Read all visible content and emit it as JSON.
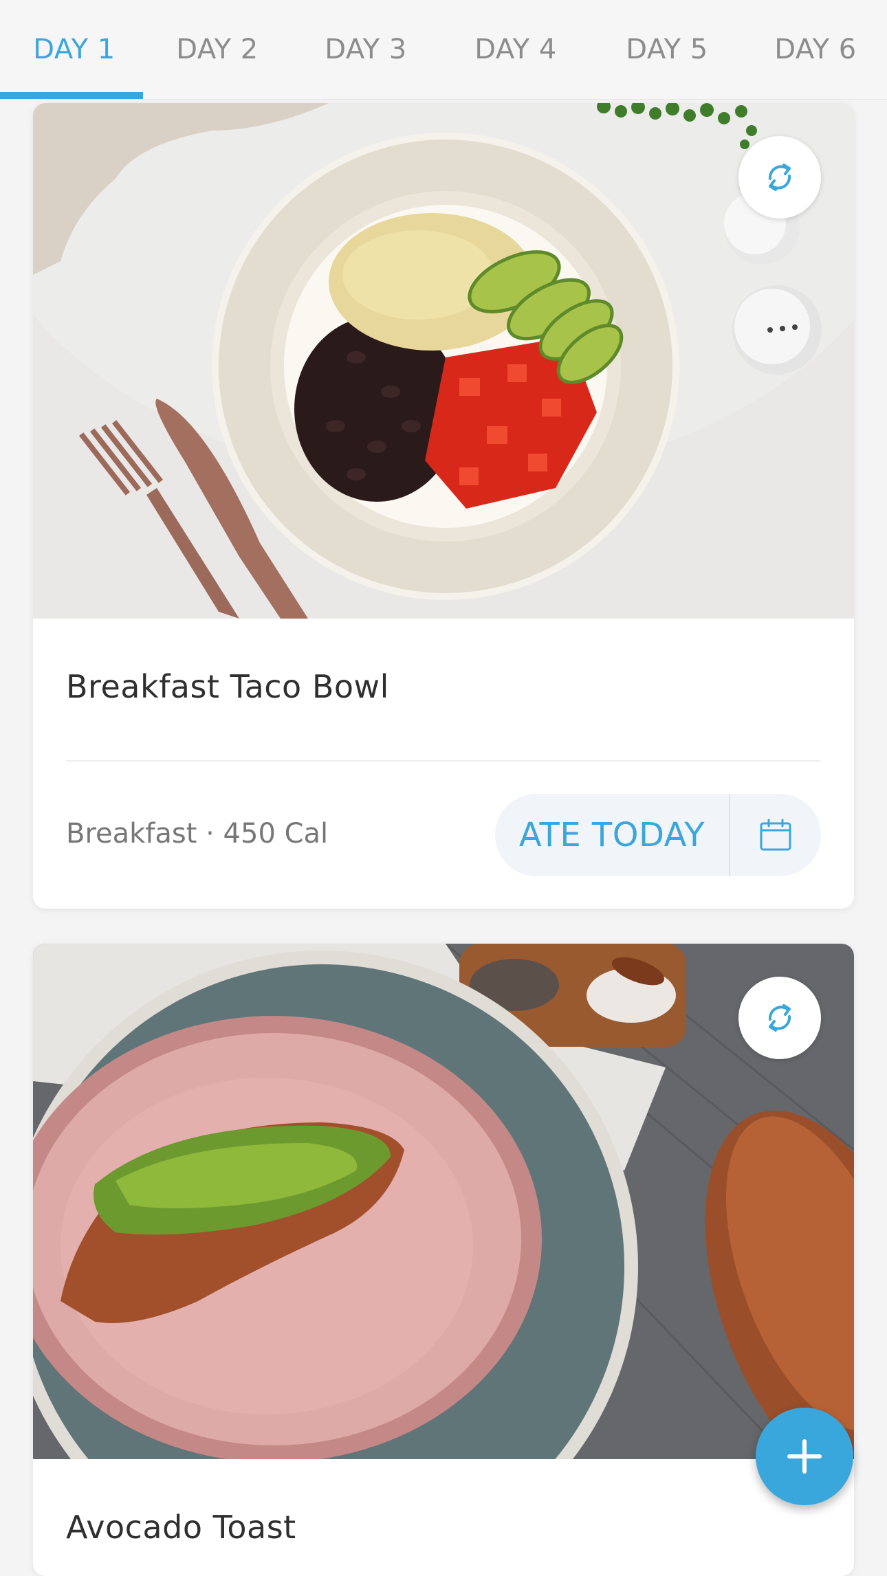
{
  "tabs": [
    {
      "label": "DAY 1",
      "active": true
    },
    {
      "label": "DAY 2",
      "active": false
    },
    {
      "label": "DAY 3",
      "active": false
    },
    {
      "label": "DAY 4",
      "active": false
    },
    {
      "label": "DAY 5",
      "active": false
    },
    {
      "label": "DAY 6",
      "active": false
    }
  ],
  "meals": [
    {
      "title": "Breakfast Taco Bowl",
      "meta": "Breakfast · 450 Cal",
      "ate_label": "ATE TODAY",
      "swap_icon": "swap-icon",
      "calendar_icon": "calendar-icon"
    },
    {
      "title": "Avocado Toast"
    }
  ],
  "fab": {
    "icon": "plus-icon"
  },
  "colors": {
    "accent": "#3aa7dc",
    "tab_inactive": "#8c8c8c",
    "background": "#f4f4f5"
  }
}
